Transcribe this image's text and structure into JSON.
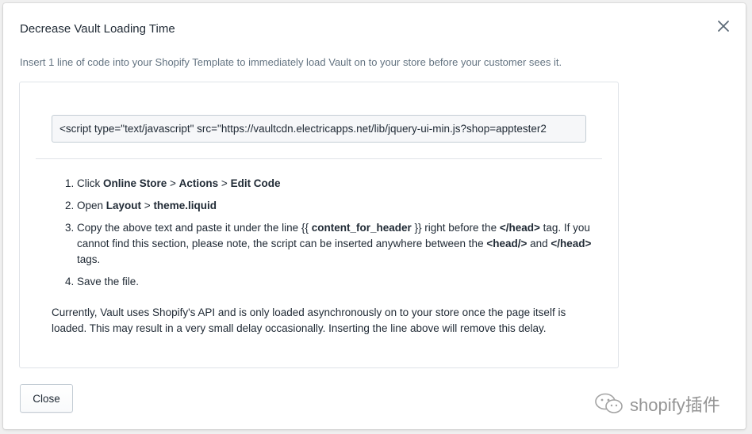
{
  "modal": {
    "title": "Decrease Vault Loading Time",
    "intro": "Insert 1 line of code into your Shopify Template to immediately load Vault on to your store before your customer sees it.",
    "close_icon": "close-icon"
  },
  "code_field": {
    "value": "<script type=\"text/javascript\" src=\"https://vaultcdn.electricapps.net/lib/jquery-ui-min.js?shop=apptester2"
  },
  "steps": [
    {
      "p1": "Click ",
      "b1": "Online Store",
      "p2": " > ",
      "b2": "Actions",
      "p3": " > ",
      "b3": "Edit Code"
    },
    {
      "p1": "Open ",
      "b1": "Layout",
      "p2": " > ",
      "b2": "theme.liquid"
    },
    {
      "p1": "Copy the above text and paste it under the line {{ ",
      "b1": "content_for_header",
      "p2": " }} right before the ",
      "b2": "</head>",
      "p3": " tag. If you cannot find this section, please note, the script can be inserted anywhere between the ",
      "b3": "<head/>",
      "p4": " and ",
      "b4": "</head>",
      "p5": " tags."
    },
    {
      "p1": "Save the file."
    }
  ],
  "note": "Currently, Vault uses Shopify's API and is only loaded asynchronously on to your store once the page itself is loaded. This may result in a very small delay occasionally. Inserting the line above will remove this delay.",
  "footer": {
    "close_label": "Close"
  },
  "watermark": {
    "text": "shopify插件",
    "icon": "wechat-icon"
  }
}
